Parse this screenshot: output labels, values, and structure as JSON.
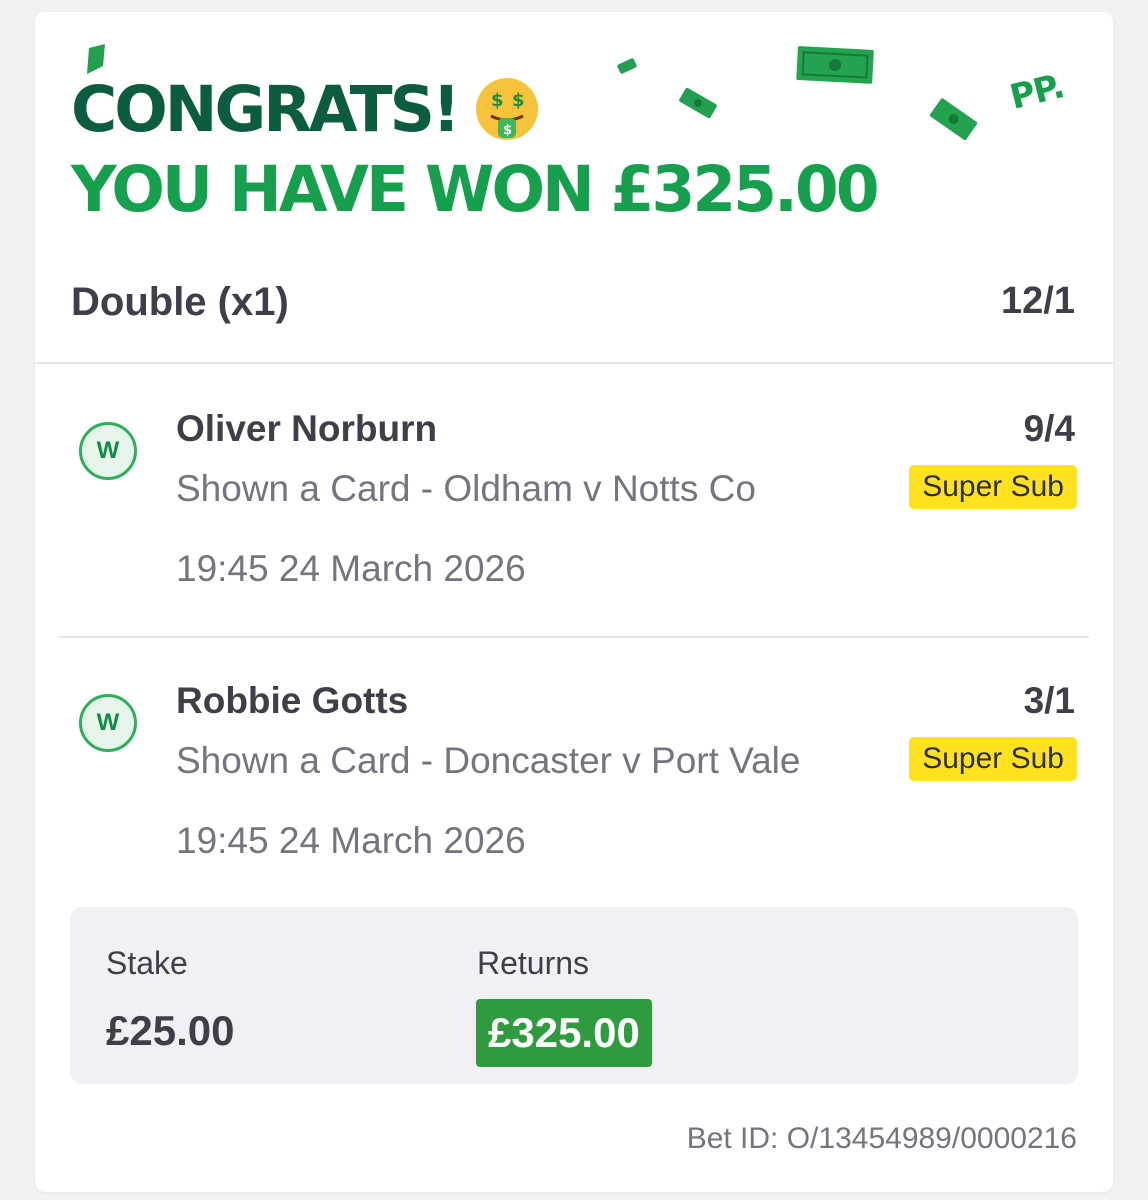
{
  "banner": {
    "congrats": "CONGRATS!",
    "won": "YOU HAVE WON £325.00",
    "logo": "PP.",
    "emoji": "money-mouth-face-icon"
  },
  "bet": {
    "type": "Double (x1)",
    "odds": "12/1"
  },
  "selections": [
    {
      "result": "W",
      "name": "Oliver Norburn",
      "market": "Shown a Card - Oldham v Notts Co",
      "date": "19:45 24 March 2026",
      "odds": "9/4",
      "tag": "Super Sub"
    },
    {
      "result": "W",
      "name": "Robbie Gotts",
      "market": "Shown a Card - Doncaster v Port Vale",
      "date": "19:45 24 March 2026",
      "odds": "3/1",
      "tag": "Super Sub"
    }
  ],
  "summary": {
    "stake_label": "Stake",
    "stake_value": "£25.00",
    "returns_label": "Returns",
    "returns_value": "£325.00"
  },
  "bet_id": "Bet ID: O/13454989/0000216",
  "colors": {
    "dark_green": "#0b5d3d",
    "brand_green": "#16a04e",
    "returns_green": "#2f9a3e",
    "super_sub_yellow": "#ffe21f"
  }
}
